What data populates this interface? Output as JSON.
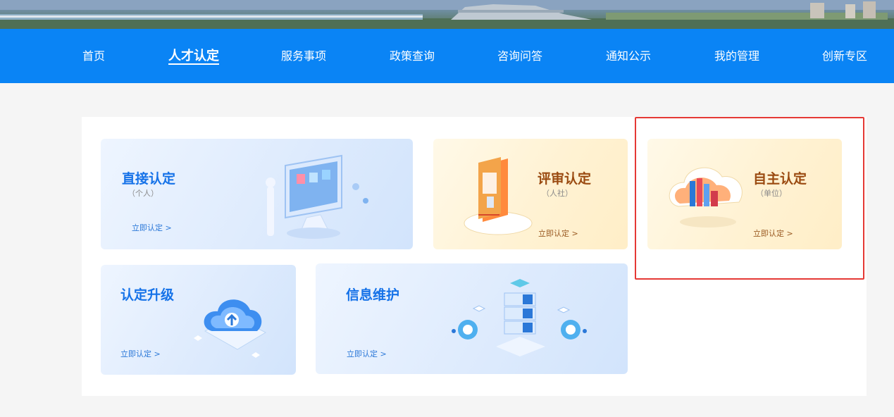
{
  "nav": {
    "items": [
      {
        "label": "首页",
        "active": false
      },
      {
        "label": "人才认定",
        "active": true
      },
      {
        "label": "服务事项",
        "active": false
      },
      {
        "label": "政策查询",
        "active": false
      },
      {
        "label": "咨询问答",
        "active": false
      },
      {
        "label": "通知公示",
        "active": false
      },
      {
        "label": "我的管理",
        "active": false
      },
      {
        "label": "创新专区",
        "active": false
      }
    ]
  },
  "cards": {
    "direct": {
      "title": "直接认定",
      "sub": "（个人）",
      "link": "立即认定 >"
    },
    "review": {
      "title": "评审认定",
      "sub": "（人社）",
      "link": "立即认定 >"
    },
    "self": {
      "title": "自主认定",
      "sub": "（单位）",
      "link": "立即认定 >"
    },
    "upgrade": {
      "title": "认定升级",
      "link": "立即认定 >"
    },
    "info": {
      "title": "信息维护",
      "link": "立即认定 >"
    }
  },
  "colors": {
    "nav_bg": "#0a84f5",
    "blue_title": "#1572e8",
    "yellow_title": "#9a4a10",
    "highlight": "#e53935"
  },
  "icons": {
    "direct": "monitor-person-icon",
    "review": "document-stand-icon",
    "self": "cloud-books-icon",
    "upgrade": "cloud-upload-icon",
    "info": "server-network-icon"
  }
}
